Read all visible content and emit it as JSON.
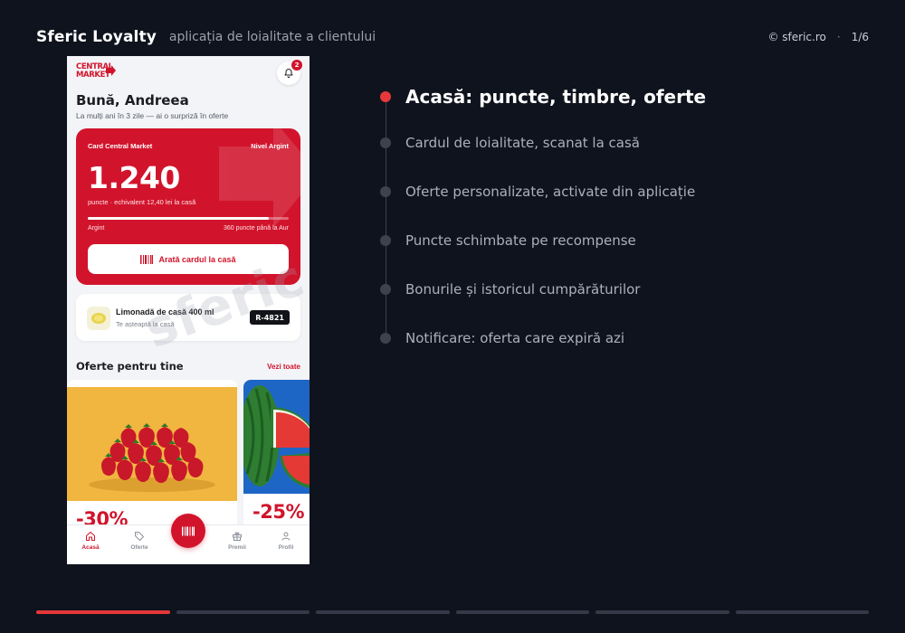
{
  "header": {
    "brand": "Sferic Loyalty",
    "tagline": "aplicația de loialitate a clientului",
    "copyright": "© sferic.ro",
    "separator": "·",
    "page_counter": "1/6"
  },
  "phone": {
    "logo": {
      "line1": "CENTRAL",
      "line2": "MARKET"
    },
    "notifications_count": "2",
    "greeting": "Bună, Andreea",
    "greeting_sub": "La mulți ani în 3 zile — ai o surpriză în oferte",
    "card": {
      "label": "Card Central Market",
      "level": "Nivel Argint",
      "points": "1.240",
      "equivalent": "puncte · echivalent 12,40 lei la casă",
      "progress_fraction": 0.9,
      "tier": "Argint",
      "next_tier": "360 puncte până la Aur",
      "button": "Arată cardul la casă"
    },
    "stamp": {
      "title": "Limonadă de casă 400 ml",
      "subtitle": "Te așteaptă la casă",
      "code": "R-4821"
    },
    "offers": {
      "title": "Oferte pentru tine",
      "see_all": "Vezi toate",
      "items": [
        {
          "discount": "-30%",
          "image": "strawberries"
        },
        {
          "discount": "-25%",
          "image": "watermelon"
        }
      ]
    },
    "tabs": [
      {
        "label": "Acasă",
        "icon": "home-icon",
        "active": true
      },
      {
        "label": "Oferte",
        "icon": "tag-icon",
        "active": false
      },
      {
        "label": "Premii",
        "icon": "gift-icon",
        "active": false
      },
      {
        "label": "Profil",
        "icon": "user-icon",
        "active": false
      }
    ]
  },
  "steps": [
    {
      "text": "Acasă: puncte, timbre, oferte",
      "active": true
    },
    {
      "text": "Cardul de loialitate, scanat la casă",
      "active": false
    },
    {
      "text": "Oferte personalizate, activate din aplicație",
      "active": false
    },
    {
      "text": "Puncte schimbate pe recompense",
      "active": false
    },
    {
      "text": "Bonurile și istoricul cumpărăturilor",
      "active": false
    },
    {
      "text": "Notificare: oferta care expiră azi",
      "active": false
    }
  ],
  "progress": {
    "current": 1,
    "total": 6
  },
  "watermark": "sferic.ro",
  "colors": {
    "accent": "#d1142c",
    "background": "#0f131d",
    "active_dot": "#e5383b"
  }
}
